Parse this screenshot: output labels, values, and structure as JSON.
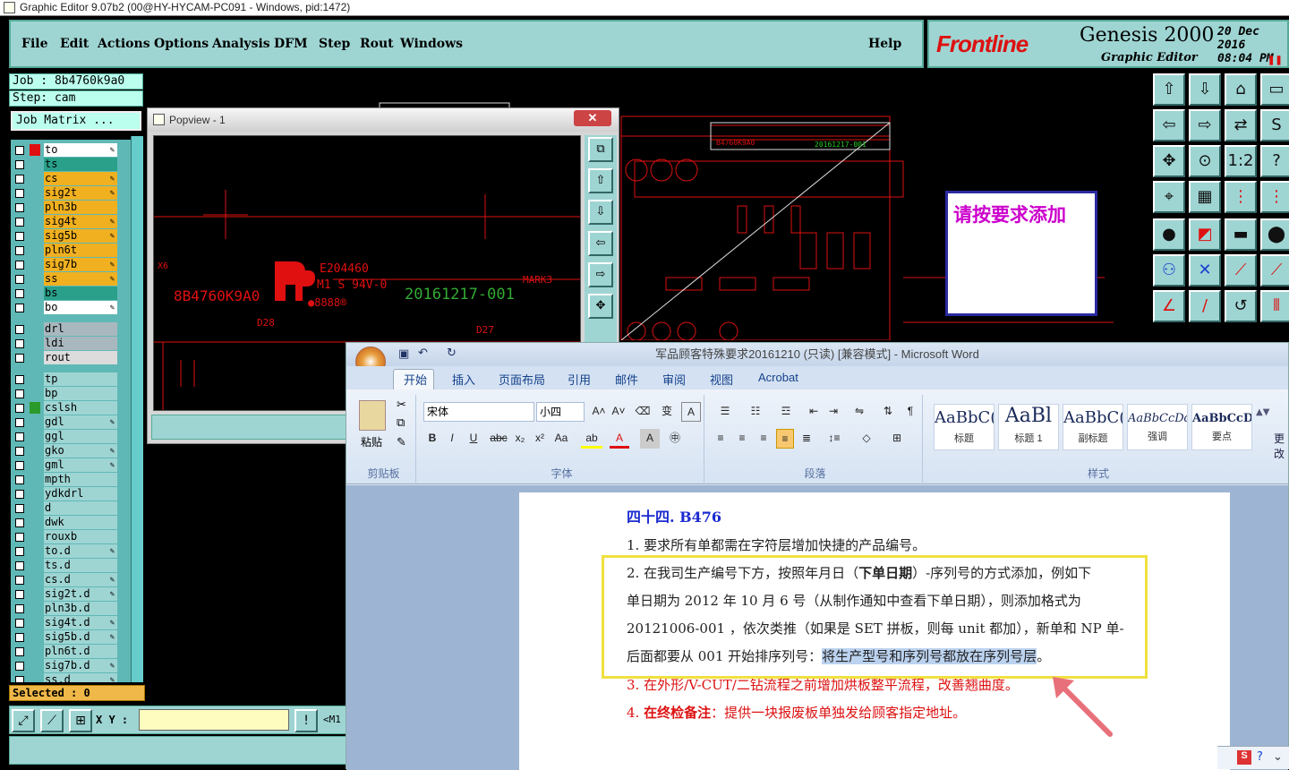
{
  "window_title": "Graphic Editor 9.07b2 (00@HY-HYCAM-PC091 - Windows, pid:1472)",
  "menu": [
    "File",
    "Edit",
    "Actions",
    "Options",
    "Analysis",
    "DFM",
    "Step",
    "Rout",
    "Windows"
  ],
  "help": "Help",
  "brand": {
    "frontline": "Frontline",
    "genesis": "Genesis 2000",
    "editor": "Graphic Editor",
    "date": "20 Dec 2016",
    "time": "08:04 PM"
  },
  "job": "Job : 8b4760k9a0",
  "step": "Step: cam",
  "job_matrix": "Job Matrix ...",
  "layers": [
    {
      "name": "to",
      "color": "#ffffff",
      "mark": "#e01010",
      "pen": true
    },
    {
      "name": "ts",
      "color": "#2aa08a",
      "mark": "",
      "pen": false
    },
    {
      "name": "cs",
      "color": "#f0b020",
      "mark": "",
      "pen": true
    },
    {
      "name": "sig2t",
      "color": "#f0b020",
      "mark": "",
      "pen": true
    },
    {
      "name": "pln3b",
      "color": "#f0b020",
      "mark": "",
      "pen": false
    },
    {
      "name": "sig4t",
      "color": "#f0b020",
      "mark": "",
      "pen": true
    },
    {
      "name": "sig5b",
      "color": "#f0b020",
      "mark": "",
      "pen": true
    },
    {
      "name": "pln6t",
      "color": "#f0b020",
      "mark": "",
      "pen": false
    },
    {
      "name": "sig7b",
      "color": "#f0b020",
      "mark": "",
      "pen": true
    },
    {
      "name": "ss",
      "color": "#f0b020",
      "mark": "",
      "pen": true
    },
    {
      "name": "bs",
      "color": "#2aa08a",
      "mark": "",
      "pen": false
    },
    {
      "name": "bo",
      "color": "#ffffff",
      "mark": "",
      "pen": true
    },
    {
      "name": "drl",
      "color": "#a9b8bf",
      "mark": "",
      "pen": false
    },
    {
      "name": "ldi",
      "color": "#a9b8bf",
      "mark": "",
      "pen": false
    },
    {
      "name": "rout",
      "color": "#dcdcdc",
      "mark": "",
      "pen": false
    },
    {
      "name": "tp",
      "color": "#9ed5d3",
      "mark": "",
      "pen": false
    },
    {
      "name": "bp",
      "color": "#9ed5d3",
      "mark": "",
      "pen": false
    },
    {
      "name": "cslsh",
      "color": "#9ed5d3",
      "mark": "#2a9a2a",
      "pen": false
    },
    {
      "name": "gdl",
      "color": "#9ed5d3",
      "mark": "",
      "pen": true
    },
    {
      "name": "ggl",
      "color": "#9ed5d3",
      "mark": "",
      "pen": false
    },
    {
      "name": "gko",
      "color": "#9ed5d3",
      "mark": "",
      "pen": true
    },
    {
      "name": "gml",
      "color": "#9ed5d3",
      "mark": "",
      "pen": true
    },
    {
      "name": "mpth",
      "color": "#9ed5d3",
      "mark": "",
      "pen": false
    },
    {
      "name": "ydkdrl",
      "color": "#9ed5d3",
      "mark": "",
      "pen": false
    },
    {
      "name": "d",
      "color": "#9ed5d3",
      "mark": "",
      "pen": false
    },
    {
      "name": "dwk",
      "color": "#9ed5d3",
      "mark": "",
      "pen": false
    },
    {
      "name": "rouxb",
      "color": "#9ed5d3",
      "mark": "",
      "pen": false
    },
    {
      "name": "to.d",
      "color": "#9ed5d3",
      "mark": "",
      "pen": true
    },
    {
      "name": "ts.d",
      "color": "#9ed5d3",
      "mark": "",
      "pen": false
    },
    {
      "name": "cs.d",
      "color": "#9ed5d3",
      "mark": "",
      "pen": true
    },
    {
      "name": "sig2t.d",
      "color": "#9ed5d3",
      "mark": "",
      "pen": true
    },
    {
      "name": "pln3b.d",
      "color": "#9ed5d3",
      "mark": "",
      "pen": false
    },
    {
      "name": "sig4t.d",
      "color": "#9ed5d3",
      "mark": "",
      "pen": true
    },
    {
      "name": "sig5b.d",
      "color": "#9ed5d3",
      "mark": "",
      "pen": true
    },
    {
      "name": "pln6t.d",
      "color": "#9ed5d3",
      "mark": "",
      "pen": false
    },
    {
      "name": "sig7b.d",
      "color": "#9ed5d3",
      "mark": "",
      "pen": true
    },
    {
      "name": "ss.d",
      "color": "#9ed5d3",
      "mark": "",
      "pen": true
    }
  ],
  "selected": "Selected : 0",
  "xy_label": "X Y :",
  "m_label": "<M1",
  "popview": {
    "title": "Popview - 1",
    "close": "✕"
  },
  "canvas_texts": {
    "job_red": "8B4760K9A0",
    "ul": "E204460",
    "ul2": "M1 S 94V-0",
    "date_green": "20161217-001",
    "mark": "MARK3",
    "d28": "D28",
    "d27": "D27",
    "x6": "X6",
    "small_job": "B4760K9A0",
    "small_date": "20161217-001"
  },
  "note": "请按要求添加",
  "word": {
    "title": "军品顾客特殊要求20161210 (只读) [兼容模式] - Microsoft Word",
    "tabs": [
      "开始",
      "插入",
      "页面布局",
      "引用",
      "邮件",
      "审阅",
      "视图",
      "Acrobat"
    ],
    "groups": {
      "clipboard": "剪贴板",
      "font": "字体",
      "paragraph": "段落",
      "styles": "样式"
    },
    "paste": "粘贴",
    "font_name": "宋体",
    "font_size": "小四",
    "styles": [
      {
        "sample": "AaBbC(",
        "label": "标题"
      },
      {
        "sample": "AaBl",
        "label": "标题 1"
      },
      {
        "sample": "AaBbC(",
        "label": "副标题"
      },
      {
        "sample": "AaBbCcDd",
        "label": "强调"
      },
      {
        "sample": "AaBbCcD",
        "label": "要点"
      }
    ],
    "more": "更改",
    "heading": "四十四. B476",
    "line1": "1. 要求所有单都需在字符层增加快捷的产品编号。",
    "line2a": "2. 在我司生产编号下方，按照年月日（",
    "line2b": "下单日期",
    "line2c": "）-序列号的方式添加，例如下",
    "line3": "单日期为 2012 年 10 月 6 号（从制作通知中查看下单日期），则添加格式为",
    "line4": "20121006-001 ，依次类推（如果是 SET 拼板，则每 unit 都加），新单和 NP 单-",
    "line5a": "后面都要从 001 开始排序列号：",
    "line5b": "将生产型号和序列号都放在序列号层",
    "line5c": "。",
    "line6": "3. 在外形/V-CUT/二钻流程之前增加烘板整平流程，改善翘曲度。",
    "line7a": "4. ",
    "line7b": "在终检备注",
    "line7c": "：提供一块报废板单独发给顾客指定地址。"
  }
}
